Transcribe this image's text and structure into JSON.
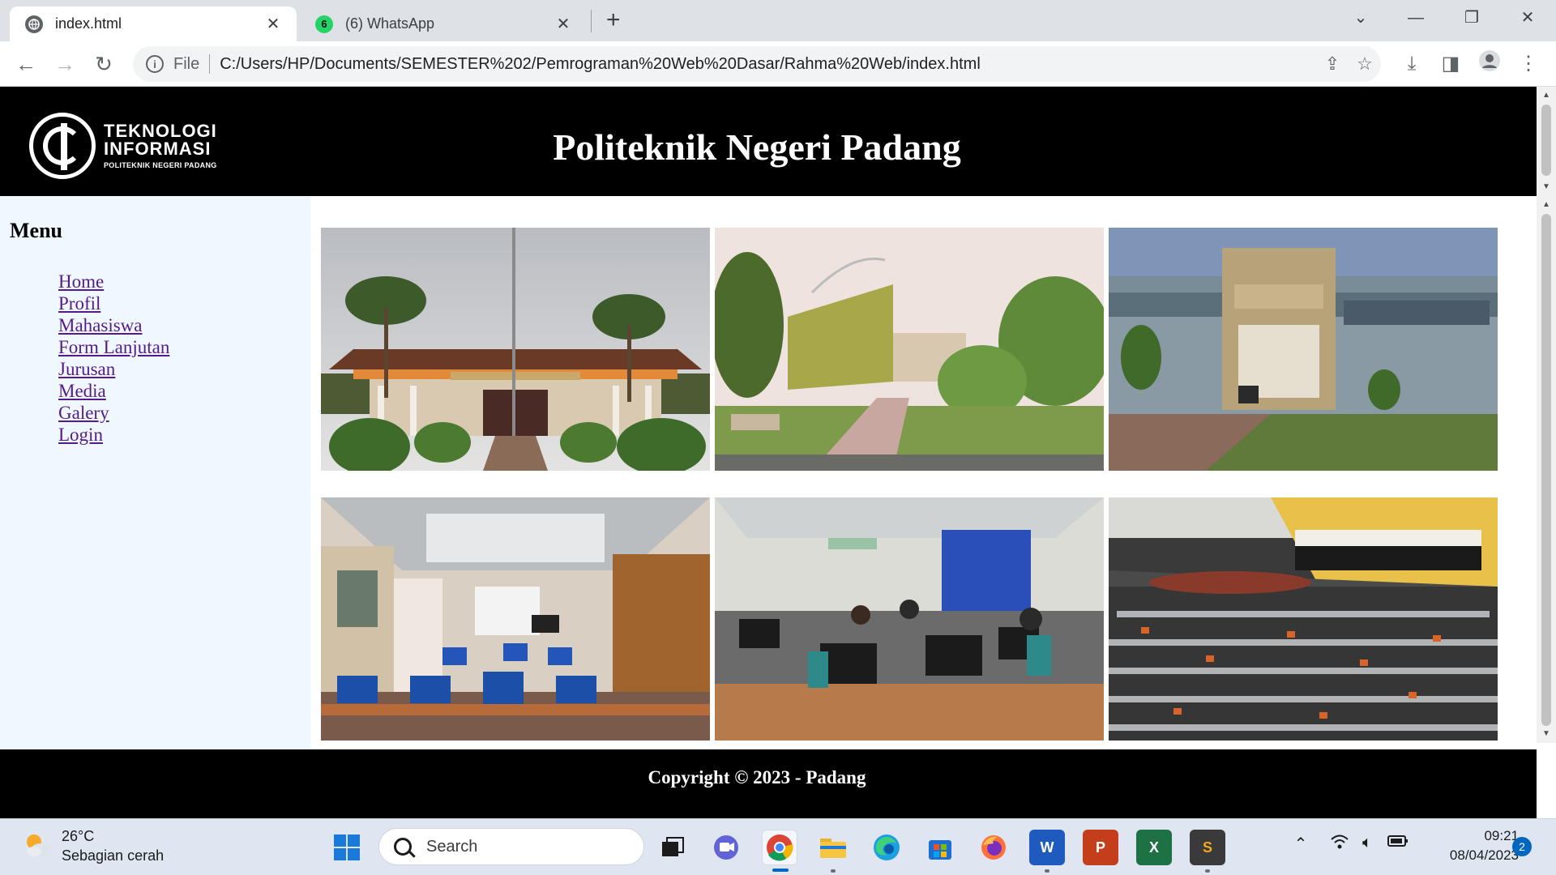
{
  "browser": {
    "tabs": [
      {
        "label": "index.html",
        "icon": "globe-icon"
      },
      {
        "label": "(6) WhatsApp",
        "icon": "whatsapp-icon",
        "badge": "6"
      }
    ],
    "address": {
      "scheme_label": "File",
      "url": "C:/Users/HP/Documents/SEMESTER%202/Pemrograman%20Web%20Dasar/Rahma%20Web/index.html"
    }
  },
  "site": {
    "logo": {
      "line1": "TEKNOLOGI",
      "line2": "INFORMASI",
      "line3": "POLITEKNIK NEGERI PADANG"
    },
    "title": "Politeknik Negeri Padang",
    "menu": {
      "title": "Menu",
      "items": [
        "Home",
        "Profil",
        "Mahasiswa",
        "Form Lanjutan",
        "Jurusan",
        "Media",
        "Galery",
        "Login"
      ]
    },
    "gallery": [
      {
        "subject": "campus-main-building"
      },
      {
        "subject": "campus-garden-building"
      },
      {
        "subject": "pkm-building"
      },
      {
        "subject": "computer-lab-empty"
      },
      {
        "subject": "computer-lab-students"
      },
      {
        "subject": "graduation-ceremony"
      }
    ],
    "footer": "Copyright © 2023 - Padang"
  },
  "taskbar": {
    "weather": {
      "temp": "26°C",
      "desc": "Sebagian cerah"
    },
    "search_placeholder": "Search",
    "time": "09:21",
    "date": "08/04/2023",
    "notifications": "2"
  }
}
